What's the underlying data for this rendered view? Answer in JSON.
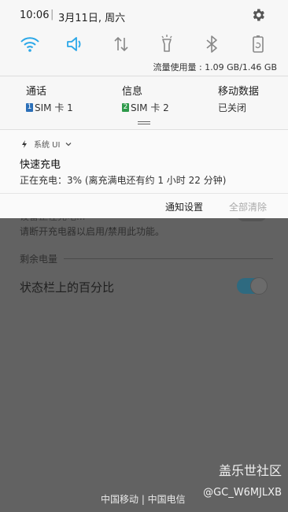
{
  "status_bar": {
    "time": "10:06",
    "separator": "|",
    "date": "3月11日, 周六",
    "settings_icon": "gear-icon"
  },
  "quick_settings": {
    "icons": [
      "wifi-icon",
      "volume-icon",
      "mobile-data-icon",
      "flashlight-icon",
      "bluetooth-icon",
      "auto-rotate-icon"
    ],
    "accent_color": "#2aa7e8",
    "inactive_color": "#888888",
    "data_usage": "流量使用量 : 1.09 GB/1.46 GB"
  },
  "sim": {
    "call": {
      "label": "通话",
      "badge": "1",
      "value": "SIM 卡 1",
      "badge_color": "#2b6fb8"
    },
    "message": {
      "label": "信息",
      "badge": "2",
      "value": "SIM 卡 2",
      "badge_color": "#2e9a4a"
    },
    "mobile_data": {
      "label": "移动数据",
      "value": "已关闭"
    }
  },
  "notification": {
    "source": "系统 UI",
    "title": "快速充电",
    "body": "正在充电：3% (离充满电还有约 1 小时 22 分钟)",
    "action_settings": "通知设置",
    "action_clear": "全部清除"
  },
  "background": {
    "partial_text": "设备正在充电...",
    "hint": "请断开充电器以启用/禁用此功能。",
    "section": "剩余电量",
    "setting_title": "状态栏上的百分比",
    "toggle_on": true,
    "carriers": "中国移动 | 中国电信",
    "watermark": "盖乐世社区",
    "watermark_user": "@GC_W6MJLXB"
  }
}
